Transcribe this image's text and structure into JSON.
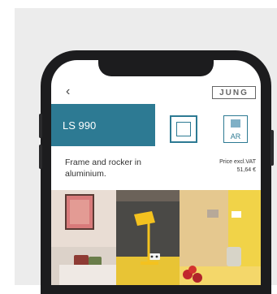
{
  "header": {
    "back_label": "‹",
    "brand": "JUNG"
  },
  "product": {
    "name": "LS 990",
    "description": "Frame and rocker in aluminium."
  },
  "icons": {
    "frame": "frame-icon",
    "ar": "ar-icon",
    "ar_label": "AR"
  },
  "price": {
    "label": "Price excl.VAT",
    "value": "51,64 €"
  },
  "colors": {
    "accent": "#2d7a93",
    "phone": "#1c1c1e"
  }
}
